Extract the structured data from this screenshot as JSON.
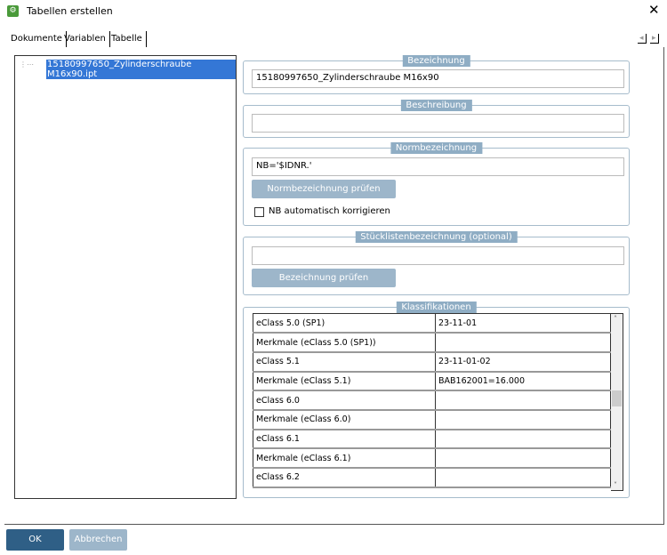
{
  "window": {
    "title": "Tabellen erstellen",
    "close": "✕"
  },
  "tabs": [
    "Dokumente",
    "Variablen",
    "Tabelle"
  ],
  "tab_nav": {
    "prev": "◂",
    "next": "▸"
  },
  "tree": {
    "items": [
      "15180997650_Zylinderschraube M16x90.ipt"
    ],
    "dots": "⋮⋯"
  },
  "bezeichnung": {
    "legend": "Bezeichnung",
    "value": "15180997650_Zylinderschraube M16x90"
  },
  "beschreibung": {
    "legend": "Beschreibung",
    "value": ""
  },
  "norm": {
    "legend": "Normbezeichnung",
    "value": "NB='$IDNR.'",
    "button": "Normbezeichnung prüfen",
    "checkbox": "NB automatisch korrigieren",
    "checked": false
  },
  "stueck": {
    "legend": "Stücklistenbezeichnung (optional)",
    "value": "",
    "button": "Bezeichnung  prüfen"
  },
  "klass": {
    "legend": "Klassifikationen",
    "rows": [
      [
        "eClass 5.0 (SP1)",
        "23-11-01"
      ],
      [
        "Merkmale (eClass 5.0 (SP1))",
        ""
      ],
      [
        "eClass 5.1",
        "23-11-01-02"
      ],
      [
        "Merkmale (eClass 5.1)",
        "BAB162001=16.000"
      ],
      [
        "eClass 6.0",
        ""
      ],
      [
        "Merkmale (eClass 6.0)",
        ""
      ],
      [
        "eClass 6.1",
        ""
      ],
      [
        "Merkmale (eClass 6.1)",
        ""
      ],
      [
        "eClass 6.2",
        ""
      ]
    ]
  },
  "buttons": {
    "ok": "OK",
    "cancel": "Abbrechen"
  }
}
